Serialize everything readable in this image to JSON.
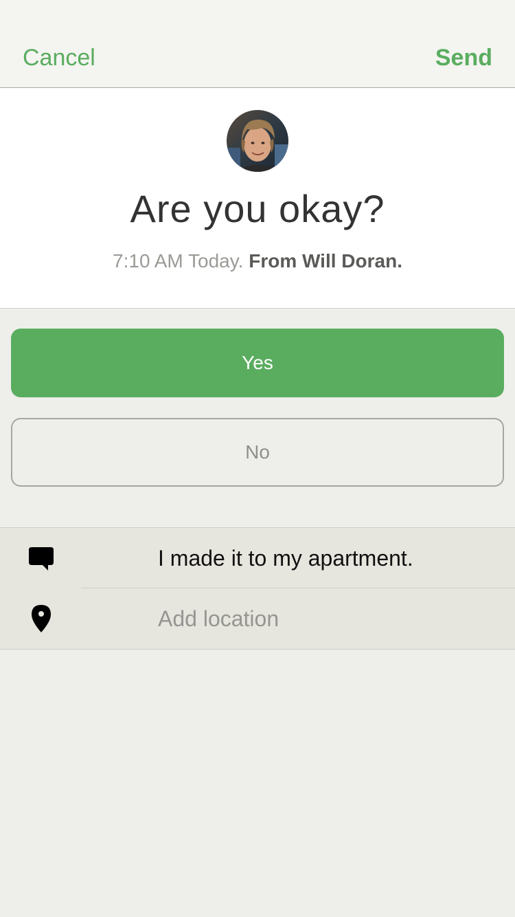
{
  "navbar": {
    "cancel_label": "Cancel",
    "send_label": "Send"
  },
  "prompt": {
    "avatar_icon": "person-avatar",
    "title": "Are you okay?",
    "time": "7:10 AM Today.",
    "sender": "From Will Doran."
  },
  "responses": {
    "yes_label": "Yes",
    "no_label": "No"
  },
  "details": {
    "message_icon": "chat-bubble-icon",
    "message_text": "I made it to my apartment.",
    "location_icon": "map-pin-icon",
    "location_placeholder": "Add location"
  },
  "colors": {
    "accent": "#5aad5f",
    "background": "#eeeeea",
    "details_background": "#e6e5de"
  }
}
